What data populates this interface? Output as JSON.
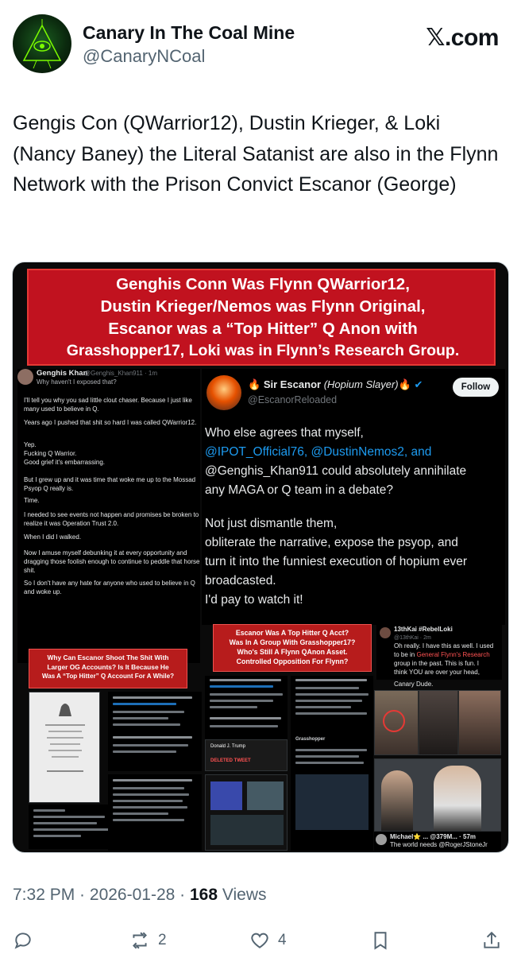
{
  "author": {
    "name": "Canary In The Coal Mine",
    "handle": "@CanaryNCoal"
  },
  "brand": "𝕏.com",
  "tweet_text": "Gengis Con (QWarrior12), Dustin Krieger, & Loki (Nancy Baney) the Literal Satanist are also in the Flynn Network with the Prison Convict Escanor (George)",
  "media": {
    "headline": [
      "Genghis Conn Was Flynn QWarrior12,",
      "Dustin Krieger/Nemos was Flynn Original,",
      "Escanor was a “Top Hitter” Q Anon with",
      "Grasshopper17, Loki was in Flynn’s Research Group."
    ],
    "genghis": {
      "name": "Genghis Khan",
      "handle": "@Genghis_Khan911 · 1m",
      "subtitle": "Why haven't I exposed that?",
      "paragraphs": [
        "I'll tell you why you sad little clout chaser. Because I just like many used to believe in Q.",
        "Years ago I pushed that shit so hard I was called QWarrior12.",
        "Yep.\nFucking Q Warrior.\nGood grief it's embarrassing.",
        "But I grew up and it was time that woke me up to the Mossad Psyop Q really is.",
        "Time.",
        "I needed to see events not happen and promises be broken to realize it was Operation Trust 2.0.",
        "When I did I walked.",
        "Now I amuse myself debunking it at every opportunity and dragging those foolish enough to continue to peddle that horse shit.",
        "So I don't have any hate for anyone who used to believe in Q and woke up."
      ]
    },
    "escanor": {
      "name": "Sir Escanor",
      "name_suffix": "(Hopium Slayer)",
      "handle": "@EscanorReloaded",
      "follow_label": "Follow",
      "text_lines": [
        "Who else agrees that myself,",
        "@IPOT_Official76, @DustinNemos2, and",
        "@Genghis_Khan911 could absolutely annihilate",
        "any MAGA or Q team in a debate?",
        "",
        "Not just dismantle them,",
        "obliterate the narrative, expose the psyop, and",
        "turn it into the funniest execution of hopium ever",
        "broadcasted.",
        "I'd pay to watch it!"
      ]
    },
    "boxes": {
      "left": [
        "Why Can Escanor Shoot The Shit With",
        "Larger OG Accounts? Is It Because He",
        "Was A “Top Hitter” Q Account For A While?"
      ],
      "middle": [
        "Escanor Was A Top Hitter Q Acct?",
        "Was In A Group With Grasshopper17?",
        "Who's Still A Flynn QAnon Asset.",
        "Controlled Opposition For Flynn?"
      ]
    },
    "kai": {
      "name": "13thKai #RebelLoki",
      "handle": "@13thKai · 2m",
      "lines": [
        "Oh really. I have this as well. I used",
        "to be in ",
        "General Flynn's Research",
        "group in the past. This is fun. I",
        "think YOU are over your head,",
        "Canary Dude."
      ]
    },
    "michael": {
      "name": "Michael⭐ ... @379M... · 57m",
      "text": "The world needs @RogerJStoneJr"
    },
    "small_labels": {
      "grasshopper": "Grasshopper",
      "trump": "Donald J. Trump",
      "deleted": "DELETED TWEET"
    }
  },
  "meta": {
    "time": "7:32 PM",
    "date": "2026-01-28",
    "views_count": "168",
    "views_label": "Views",
    "separator": " · "
  },
  "actions": {
    "reply_count": "",
    "repost_count": "2",
    "like_count": "4",
    "bookmark_count": ""
  },
  "colors": {
    "link": "#1d9bf0",
    "headline_bg": "#c1121f",
    "text_dark": "#0f1419",
    "text_muted": "#536471"
  }
}
